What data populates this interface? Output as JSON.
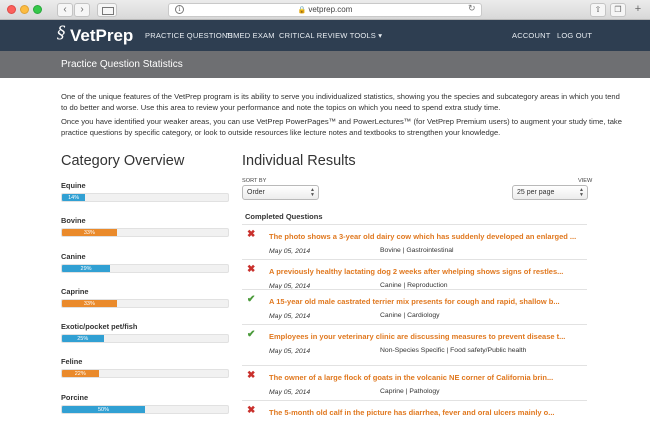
{
  "browser": {
    "url": "vetprep.com"
  },
  "site": {
    "logo": "VetPrep",
    "nav": {
      "practice_questions": "PRACTICE QUESTIONS",
      "timed_exam": "TIMED EXAM",
      "critical_review": "CRITICAL REVIEW TOOLS",
      "account": "ACCOUNT",
      "logout": "LOG OUT"
    }
  },
  "page": {
    "title": "Practice Question Statistics",
    "intro_p1": "One of the unique features of the VetPrep program is its ability to serve you individualized statistics, showing you the species and subcategory areas in which you tend to do better and worse. Use this area to review your performance and note the topics on which you need to spend extra study time.",
    "intro_p2": "Once you have identified your weaker areas, you can use VetPrep PowerPages™ and PowerLectures™ (for VetPrep Premium users) to augment your study time, take practice questions by specific category, or look to outside resources like lecture notes and textbooks to strengthen your knowledge."
  },
  "category_overview": {
    "heading": "Category Overview",
    "items": [
      {
        "label": "Equine",
        "percent_text": "14%",
        "value": 14,
        "color": "#31a0d3"
      },
      {
        "label": "Bovine",
        "percent_text": "33%",
        "value": 33,
        "color": "#ea8a2b"
      },
      {
        "label": "Canine",
        "percent_text": "29%",
        "value": 29,
        "color": "#31a0d3"
      },
      {
        "label": "Caprine",
        "percent_text": "33%",
        "value": 33,
        "color": "#ea8a2b"
      },
      {
        "label": "Exotic/pocket pet/fish",
        "percent_text": "25%",
        "value": 25,
        "color": "#31a0d3"
      },
      {
        "label": "Feline",
        "percent_text": "22%",
        "value": 22,
        "color": "#ea8a2b"
      },
      {
        "label": "Porcine",
        "percent_text": "50%",
        "value": 50,
        "color": "#31a0d3"
      }
    ]
  },
  "results": {
    "heading": "Individual Results",
    "sort_by_label": "SORT BY",
    "sort_value": "Order",
    "view_label": "VIEW",
    "view_value": "25 per page",
    "completed_label": "Completed Questions",
    "rows": [
      {
        "status": "wrong",
        "icon": "x-icon",
        "text": "The photo shows a 3-year old dairy cow which has suddenly developed an enlarged ...",
        "date": "May 05, 2014",
        "category": "Bovine | Gastrointestinal"
      },
      {
        "status": "wrong",
        "icon": "x-icon",
        "text": "A previously healthy lactating dog 2 weeks after whelping shows signs of restles...",
        "date": "May 05, 2014",
        "category": "Canine | Reproduction"
      },
      {
        "status": "right",
        "icon": "check-icon",
        "text": "A 15-year old male castrated terrier mix presents for cough and rapid, shallow b...",
        "date": "May 05, 2014",
        "category": "Canine | Cardiology"
      },
      {
        "status": "right",
        "icon": "check-icon",
        "text": "Employees in your veterinary clinic are discussing measures to prevent disease t...",
        "date": "May 05, 2014",
        "category": "Non-Species Specific | Food safety/Public health"
      },
      {
        "status": "wrong",
        "icon": "x-icon",
        "text": "The owner of a large flock of goats in the volcanic NE corner of California brin...",
        "date": "May 05, 2014",
        "category": "Caprine | Pathology"
      },
      {
        "status": "wrong",
        "icon": "x-icon",
        "text": "The 5-month old calf in the picture has diarrhea, fever and oral ulcers mainly o...",
        "date": "",
        "category": ""
      }
    ]
  }
}
